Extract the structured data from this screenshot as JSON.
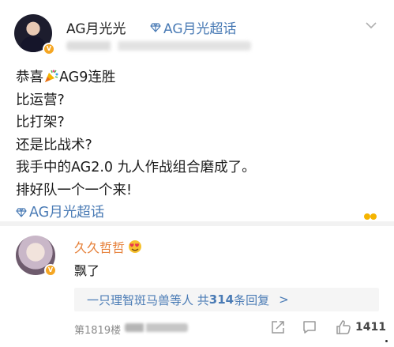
{
  "post": {
    "author": {
      "name": "AG月光光",
      "verified_badge": "V"
    },
    "supertopic_tag": "AG月光超话",
    "body_lines": [
      {
        "before_emoji": "恭喜",
        "after_emoji": "AG9连胜"
      },
      "比运营?",
      "比打架?",
      "还是比战术?",
      "我手中的AG2.0 九人作战组合磨成了。",
      "排好队一个一个来!"
    ],
    "body_tag": "AG月光超话"
  },
  "comment": {
    "author": "久久哲哲",
    "verified_badge": "V",
    "text": "飘了"
  },
  "replies": {
    "summary_prefix": "一只理智斑马兽等人 共",
    "count": "314",
    "summary_suffix": "条回复",
    "arrow": ">"
  },
  "footer": {
    "floor": "第1819楼",
    "likes": "1411"
  },
  "icons": {
    "supertopic": "diamond-icon",
    "more": "chevron-down-icon",
    "emoji_inline": "party-popper-icon",
    "comment_emoji": "heart-eyes-icon",
    "share": "share-icon",
    "comment": "comment-icon",
    "like": "thumbs-up-icon"
  },
  "colors": {
    "link": "#4a7bb5",
    "comment_author": "#e6813b",
    "badge": "#f5a623",
    "text": "#1a1a1a",
    "muted": "#8a8a8a"
  }
}
